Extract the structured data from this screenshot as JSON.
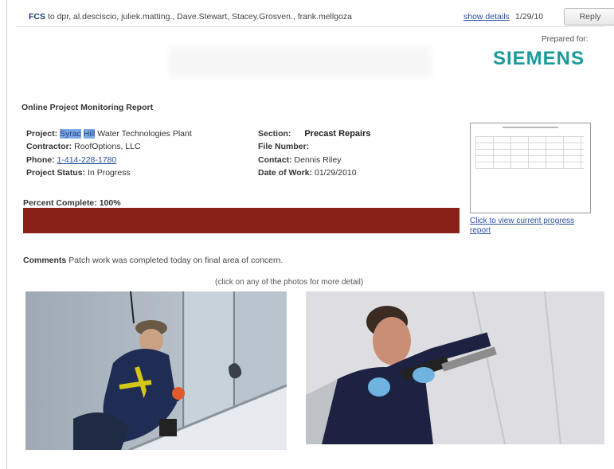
{
  "email": {
    "sender": "FCS",
    "to_line": "to dpr, al.desciscio, juliek.matting., Dave.Stewart, Stacey.Grosven., frank.mellgoza",
    "details_link": "show details",
    "date": "1/29/10",
    "reply_label": "Reply"
  },
  "brand": {
    "prepared_for": "Prepared for:",
    "name": "SIEMENS",
    "color": "#1b9a9a"
  },
  "report": {
    "title": "Online Project Monitoring Report",
    "project_label": "Project:",
    "project_highlight_1": "Syrac",
    "project_highlight_2": "Hill",
    "project_value": "Water Technologies Plant",
    "contractor_label": "Contractor:",
    "contractor_value": "RoofOptions, LLC",
    "phone_label": "Phone:",
    "phone_value": "1-414-228-1780",
    "status_label": "Project Status:",
    "status_value": "In Progress",
    "section_label": "Section:",
    "section_value": "Precast Repairs",
    "file_label": "File Number:",
    "file_value": "",
    "contact_label": "Contact:",
    "contact_value": "Dennis Riley",
    "date_label": "Date of Work:",
    "date_value": "01/29/2010"
  },
  "progress": {
    "label": "Percent Complete: 100%",
    "percent": 100,
    "fill_color": "#8b2218"
  },
  "progress_thumb": {
    "link_text": "Click to view current progress report"
  },
  "comments": {
    "label": "Comments",
    "text": "Patch work was completed today on final area of concern."
  },
  "photos": {
    "hint": "(click on any of the photos for more detail)",
    "items": [
      "worker-on-rope-photo",
      "worker-caulking-photo"
    ]
  }
}
